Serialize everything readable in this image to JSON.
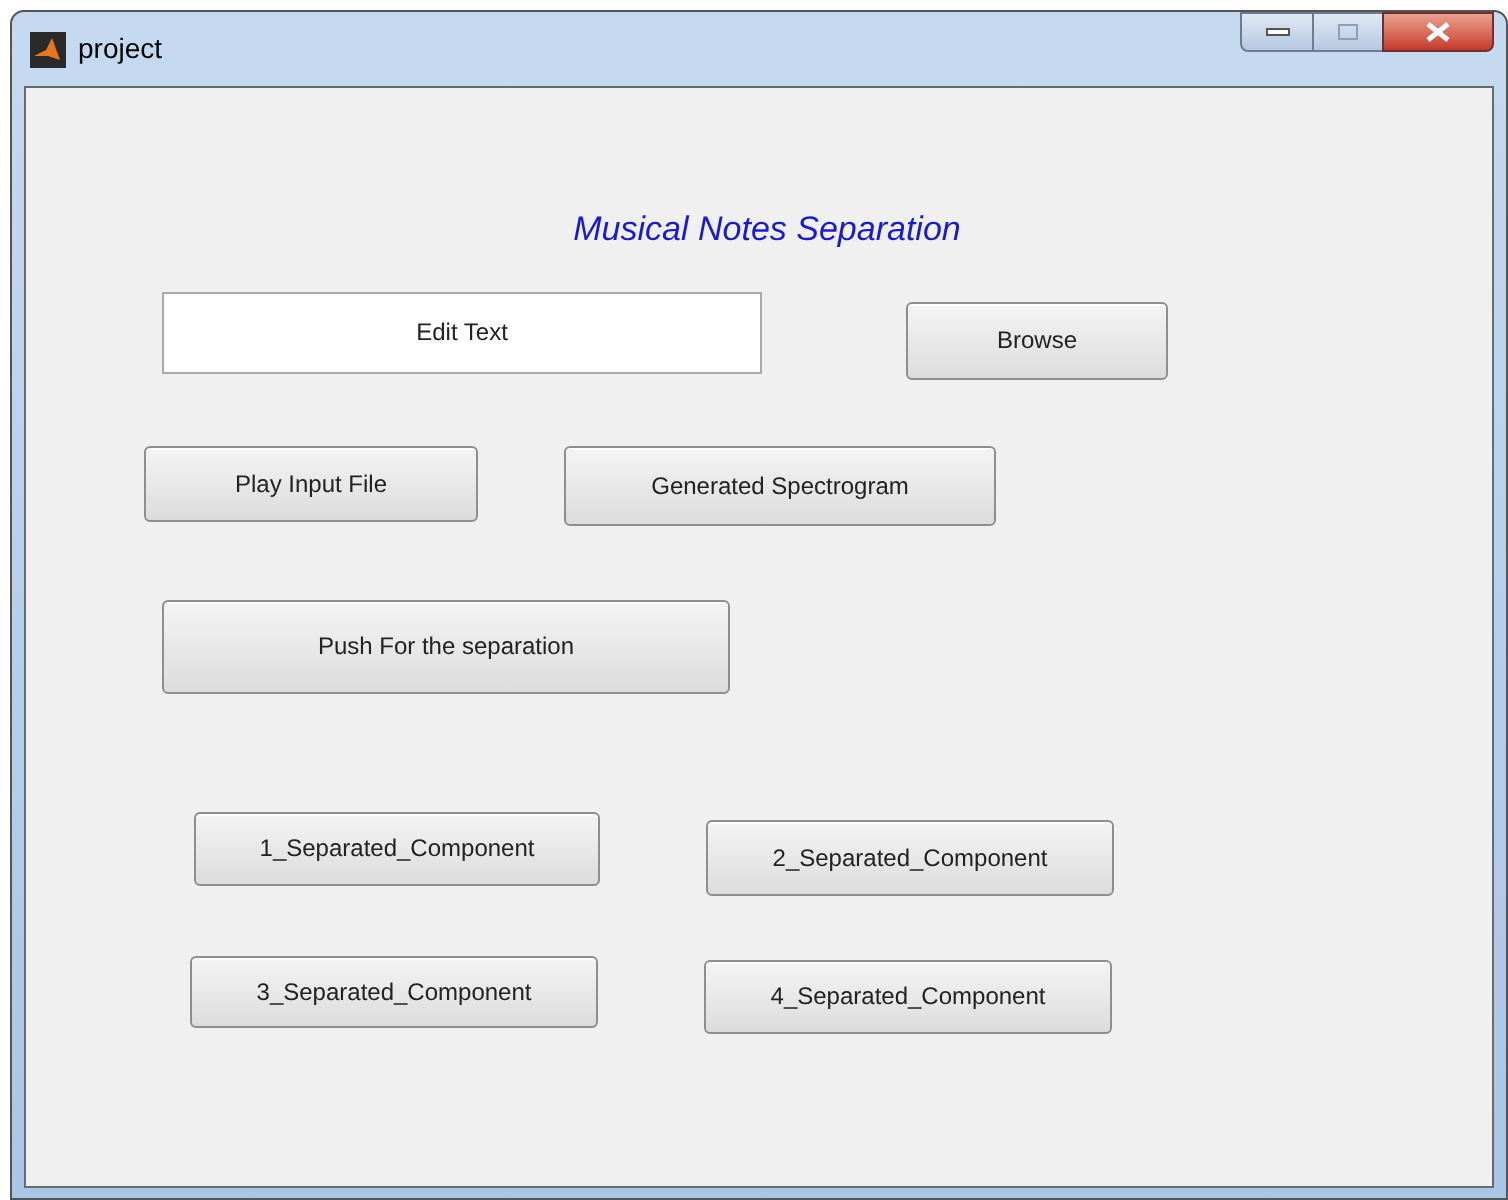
{
  "window": {
    "title": "project"
  },
  "heading": "Musical Notes Separation",
  "edit_field": {
    "value": "Edit Text"
  },
  "buttons": [
    {
      "label": "Browse"
    },
    {
      "label": "Play Input File"
    },
    {
      "label": "Generated Spectrogram"
    },
    {
      "label": "Push For the separation"
    },
    {
      "label": "1_Separated_Component"
    },
    {
      "label": "2_Separated_Component"
    },
    {
      "label": "3_Separated_Component"
    },
    {
      "label": "4_Separated_Component"
    }
  ]
}
